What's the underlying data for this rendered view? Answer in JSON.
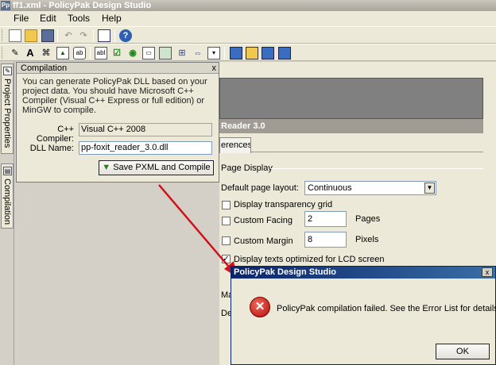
{
  "window": {
    "title": "ff1.xml - PolicyPak Design Studio",
    "app_icon_text": "Pp"
  },
  "menu": [
    "File",
    "Edit",
    "Tools",
    "Help"
  ],
  "toolbar1": {
    "icons": [
      "new-icon",
      "open-icon",
      "save-icon",
      "undo-icon",
      "redo-icon",
      "properties-icon",
      "help-icon"
    ],
    "help_glyph": "?"
  },
  "toolbar2": {
    "icons": [
      "pointer-icon",
      "text-icon",
      "label-icon",
      "image-icon",
      "textbox-icon",
      "editbox-icon",
      "checkbox-icon",
      "radio-icon",
      "groupbox-icon",
      "picture-icon",
      "tree-icon",
      "slider-icon",
      "dropdown-icon",
      "layout-icon",
      "layout-icon",
      "layout-icon",
      "layout-icon"
    ],
    "text_glyph": "A",
    "label_glyph": "ab",
    "edit_glyph": "abl"
  },
  "dock": {
    "tabs": [
      "Project Properties",
      "Compilation"
    ]
  },
  "compilation_panel": {
    "title": "Compilation",
    "close_glyph": "x",
    "info": "You can generate PolicyPak DLL based on your project data. You should have Microsoft C++ Compiler (Visual C++ Express or full edition) or MinGW to compile.",
    "compiler_label": "C++ Compiler:",
    "compiler_value": "Visual C++ 2008",
    "dll_label": "DLL Name:",
    "dll_value": "pp-foxit_reader_3.0.dll",
    "button": "Save PXML and Compile"
  },
  "background_doc": {
    "name_strip": "Reader 3.0",
    "tab": "erences",
    "section": "Page Display",
    "default_layout_label": "Default page layout:",
    "default_layout_value": "Continuous",
    "transparency_label": "Display transparency grid",
    "custom_facing_label": "Custom Facing",
    "custom_facing_value": "2",
    "pages_unit": "Pages",
    "custom_margin_label": "Custom Margin",
    "custom_margin_value": "8",
    "pixels_unit": "Pixels",
    "lcd_label": "Display texts optimized for LCD screen",
    "truncated_1": "Mag",
    "truncated_2": "De"
  },
  "error_dialog": {
    "title": "PolicyPak Design Studio",
    "message": "PolicyPak compilation failed. See the Error List for details.",
    "ok": "OK",
    "close_glyph": "x",
    "error_glyph": "✕"
  },
  "colors": {
    "arrow": "#d0121b",
    "dialog_title": "#0a246a",
    "error_icon": "#c62020"
  }
}
